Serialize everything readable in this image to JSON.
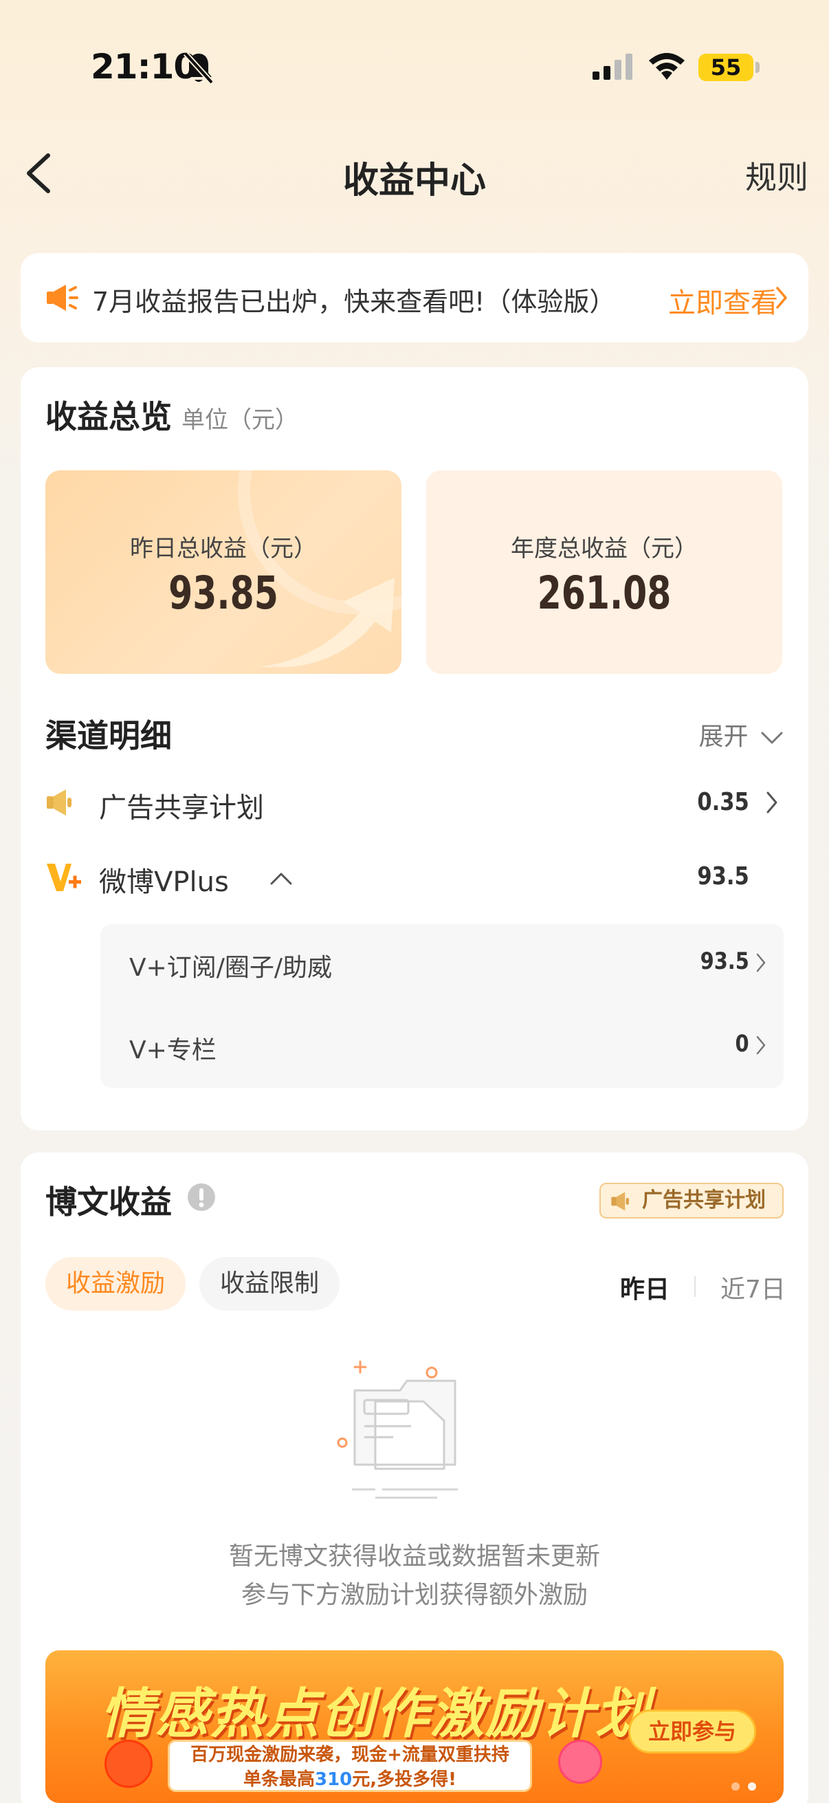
{
  "status_bar": {
    "time": "21:10",
    "battery": "55"
  },
  "nav": {
    "title": "收益中心",
    "rules": "规则"
  },
  "notice": {
    "text": "7月收益报告已出炉，快来查看吧!（体验版）",
    "link": "立即查看"
  },
  "overview": {
    "title": "收益总览",
    "unit": "单位（元）",
    "yesterday": {
      "label": "昨日总收益（元）",
      "value": "93.85"
    },
    "year": {
      "label": "年度总收益（元）",
      "value": "261.08"
    }
  },
  "channels": {
    "title": "渠道明细",
    "expand": "展开",
    "items": [
      {
        "label": "广告共享计划",
        "value": "0.35"
      },
      {
        "label": "微博VPlus",
        "value": "93.5"
      }
    ],
    "sub_items": [
      {
        "label": "V+订阅/圈子/助威",
        "value": "93.5"
      },
      {
        "label": "V+专栏",
        "value": "0"
      }
    ]
  },
  "blog": {
    "title": "博文收益",
    "badge": "广告共享计划",
    "tabs": [
      "收益激励",
      "收益限制"
    ],
    "periods": [
      "昨日",
      "近7日"
    ],
    "empty_line1": "暂无博文获得收益或数据暂未更新",
    "empty_line2": "参与下方激励计划获得额外激励",
    "banner": {
      "title": "情感热点创作激励计划",
      "sub_line1": "百万现金激励来袭，现金+流量双重扶持",
      "sub_line2_prefix": "单条最高",
      "sub_line2_highlight": "310",
      "sub_line2_suffix": "元,多投多得!",
      "button": "立即参与"
    }
  },
  "colors": {
    "accent": "#ff8a1f",
    "card": "#ffffff",
    "value_dark": "#3b2b22"
  }
}
